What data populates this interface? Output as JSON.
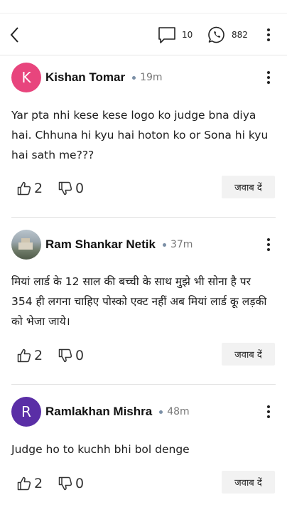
{
  "header": {
    "comments_count": "10",
    "whatsapp_count": "882"
  },
  "comments": [
    {
      "avatar_letter": "K",
      "avatar_color": "#e8457d",
      "author": "Kishan Tomar",
      "time": "19m",
      "text": "Yar pta nhi kese kese logo ko judge bna diya hai. Chhuna hi kyu hai hoton ko or Sona hi kyu hai sath me???",
      "likes": "2",
      "dislikes": "0",
      "reply_label": "जवाब दें"
    },
    {
      "avatar_letter": "",
      "avatar_color": "#9aa6ae",
      "author": "Ram Shankar Netik",
      "time": "37m",
      "text": "मियां लार्ड के 12 साल की बच्ची के साथ मुझे भी सोना है पर 354 ही लगना चाहिए पोस्को एक्ट नहीं अब मियां लार्ड कू लड़की को भेजा जाये।",
      "likes": "2",
      "dislikes": "0",
      "reply_label": "जवाब दें"
    },
    {
      "avatar_letter": "R",
      "avatar_color": "#5a2ea6",
      "author": "Ramlakhan Mishra",
      "time": "48m",
      "text": "Judge ho to kuchh bhi bol denge",
      "likes": "2",
      "dislikes": "0",
      "reply_label": "जवाब दें"
    }
  ]
}
